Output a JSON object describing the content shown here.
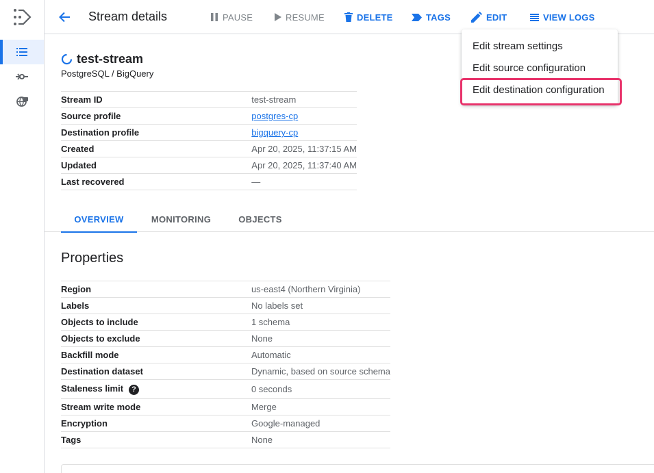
{
  "topbar": {
    "title": "Stream details",
    "actions": [
      {
        "label": "PAUSE",
        "icon": "pause-icon",
        "state": "disabled"
      },
      {
        "label": "RESUME",
        "icon": "play-icon",
        "state": "disabled"
      },
      {
        "label": "DELETE",
        "icon": "trash-icon",
        "state": "enabled"
      },
      {
        "label": "TAGS",
        "icon": "tag-icon",
        "state": "enabled"
      },
      {
        "label": "EDIT",
        "icon": "pencil-icon",
        "state": "enabled"
      },
      {
        "label": "VIEW LOGS",
        "icon": "list-icon",
        "state": "enabled"
      }
    ]
  },
  "stream": {
    "name": "test-stream",
    "subtitle": "PostgreSQL / BigQuery",
    "details": [
      {
        "key": "Stream ID",
        "value": "test-stream"
      },
      {
        "key": "Source profile",
        "value": "postgres-cp"
      },
      {
        "key": "Destination profile",
        "value": "bigquery-cp"
      },
      {
        "key": "Created",
        "value": "Apr 20, 2025, 11:37:15 AM"
      },
      {
        "key": "Updated",
        "value": "Apr 20, 2025, 11:37:40 AM"
      },
      {
        "key": "Last recovered",
        "value": "—"
      }
    ]
  },
  "tabs": [
    "OVERVIEW",
    "MONITORING",
    "OBJECTS"
  ],
  "properties": {
    "title": "Properties",
    "rows": [
      {
        "key": "Region",
        "value": "us-east4 (Northern Virginia)"
      },
      {
        "key": "Labels",
        "value": "No labels set"
      },
      {
        "key": "Objects to include",
        "value": "1 schema"
      },
      {
        "key": "Objects to exclude",
        "value": "None"
      },
      {
        "key": "Backfill mode",
        "value": "Automatic"
      },
      {
        "key": "Destination dataset",
        "value": "Dynamic, based on source schema"
      },
      {
        "key": "Staleness limit",
        "value": "0 seconds"
      },
      {
        "key": "Stream write mode",
        "value": "Merge"
      },
      {
        "key": "Encryption",
        "value": "Google-managed"
      },
      {
        "key": "Tags",
        "value": "None"
      }
    ],
    "help_glyph": "?"
  },
  "edit_menu": {
    "items": [
      "Edit stream settings",
      "Edit source configuration",
      "Edit destination configuration"
    ],
    "highlight_color": "#e8336b"
  },
  "colors": {
    "accent": "#1a73e8",
    "disabled": "#80868b"
  }
}
